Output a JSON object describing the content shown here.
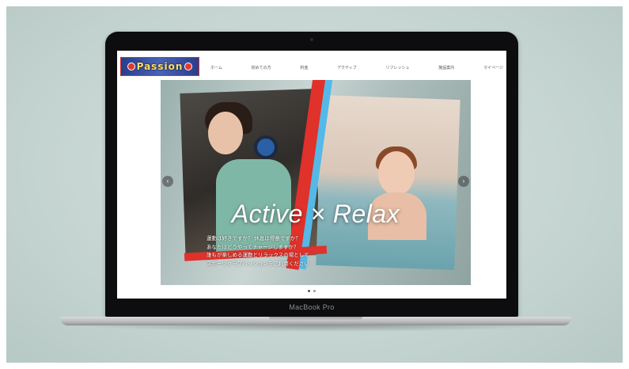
{
  "device": {
    "label": "MacBook Pro"
  },
  "site": {
    "logo_text": "Passion",
    "nav": [
      {
        "label": "ホーム"
      },
      {
        "label": "初めての方"
      },
      {
        "label": "料金"
      },
      {
        "label": "アクティブ"
      },
      {
        "label": "リフレッシュ"
      },
      {
        "label": "施設案内"
      },
      {
        "label": "マイページ"
      }
    ],
    "hero": {
      "title": "Active × Relax",
      "lines": [
        "運動は好きですか？ 休息は得意ですか？",
        "あなたはどうやってチャージしますか？",
        "誰もが楽しめる運動とリラックスの場として",
        "スポーツクラブパッションをご利用ください"
      ],
      "prev_icon": "chevron-left-icon",
      "next_icon": "chevron-right-icon",
      "prev_glyph": "‹",
      "next_glyph": "›"
    },
    "slider_dots": 2,
    "colors": {
      "accent_red": "#e0312a",
      "accent_blue": "#54b9e6",
      "logo_bg": "#2b3d8a"
    }
  }
}
